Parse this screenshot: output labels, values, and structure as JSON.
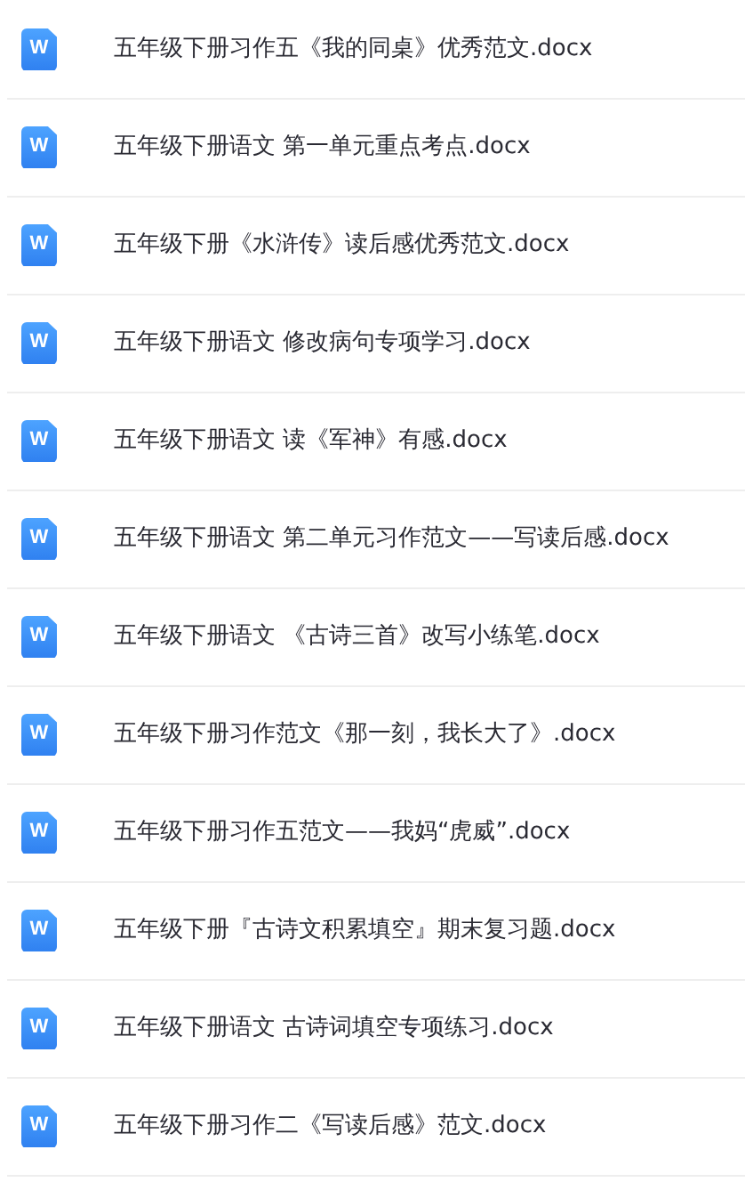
{
  "files": [
    {
      "name": "五年级下册习作五《我的同桌》优秀范文.docx",
      "icon_glyph": "W"
    },
    {
      "name": "五年级下册语文 第一单元重点考点.docx",
      "icon_glyph": "W"
    },
    {
      "name": "五年级下册《水浒传》读后感优秀范文.docx",
      "icon_glyph": "W"
    },
    {
      "name": "五年级下册语文 修改病句专项学习.docx",
      "icon_glyph": "W"
    },
    {
      "name": "五年级下册语文 读《军神》有感.docx",
      "icon_glyph": "W"
    },
    {
      "name": "五年级下册语文 第二单元习作范文——写读后感.docx",
      "icon_glyph": "W"
    },
    {
      "name": "五年级下册语文 《古诗三首》改写小练笔.docx",
      "icon_glyph": "W"
    },
    {
      "name": "五年级下册习作范文《那一刻，我长大了》.docx",
      "icon_glyph": "W"
    },
    {
      "name": "五年级下册习作五范文——我妈“虎威”.docx",
      "icon_glyph": "W"
    },
    {
      "name": "五年级下册『古诗文积累填空』期末复习题.docx",
      "icon_glyph": "W"
    },
    {
      "name": "五年级下册语文 古诗词填空专项练习.docx",
      "icon_glyph": "W"
    },
    {
      "name": "五年级下册习作二《写读后感》范文.docx",
      "icon_glyph": "W"
    }
  ]
}
